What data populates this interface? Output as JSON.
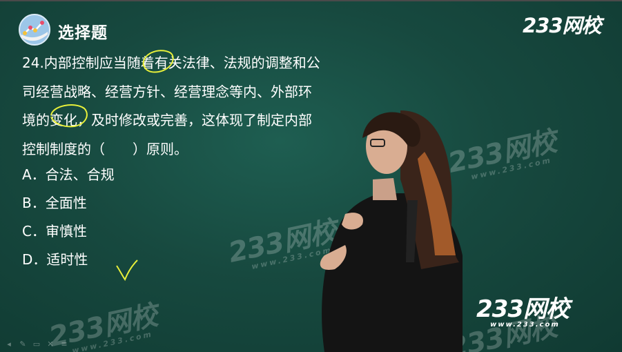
{
  "header": {
    "section_title": "选择题",
    "brand": "233网校"
  },
  "question": {
    "lines": [
      "24.内部控制应当随着有关法律、法规的调整和公",
      "司经营战略、经营方针、经营理念等内、外部环",
      "境的变化，及时修改或完善，这体现了制定内部",
      "控制制度的（　　）原则。"
    ]
  },
  "options": [
    {
      "label": "A．合法、合规"
    },
    {
      "label": "B．全面性"
    },
    {
      "label": "C．审慎性"
    },
    {
      "label": "D．适时性"
    }
  ],
  "watermarks": {
    "brand": "233网校",
    "url": "www.233.com"
  },
  "bottom_brand": {
    "name": "233网校",
    "url": "www.233.com"
  },
  "annotation_color": "#e8f03a",
  "toolbar": {
    "icons": [
      "back-icon",
      "pen-icon",
      "eraser-icon",
      "clear-icon",
      "menu-icon"
    ]
  }
}
